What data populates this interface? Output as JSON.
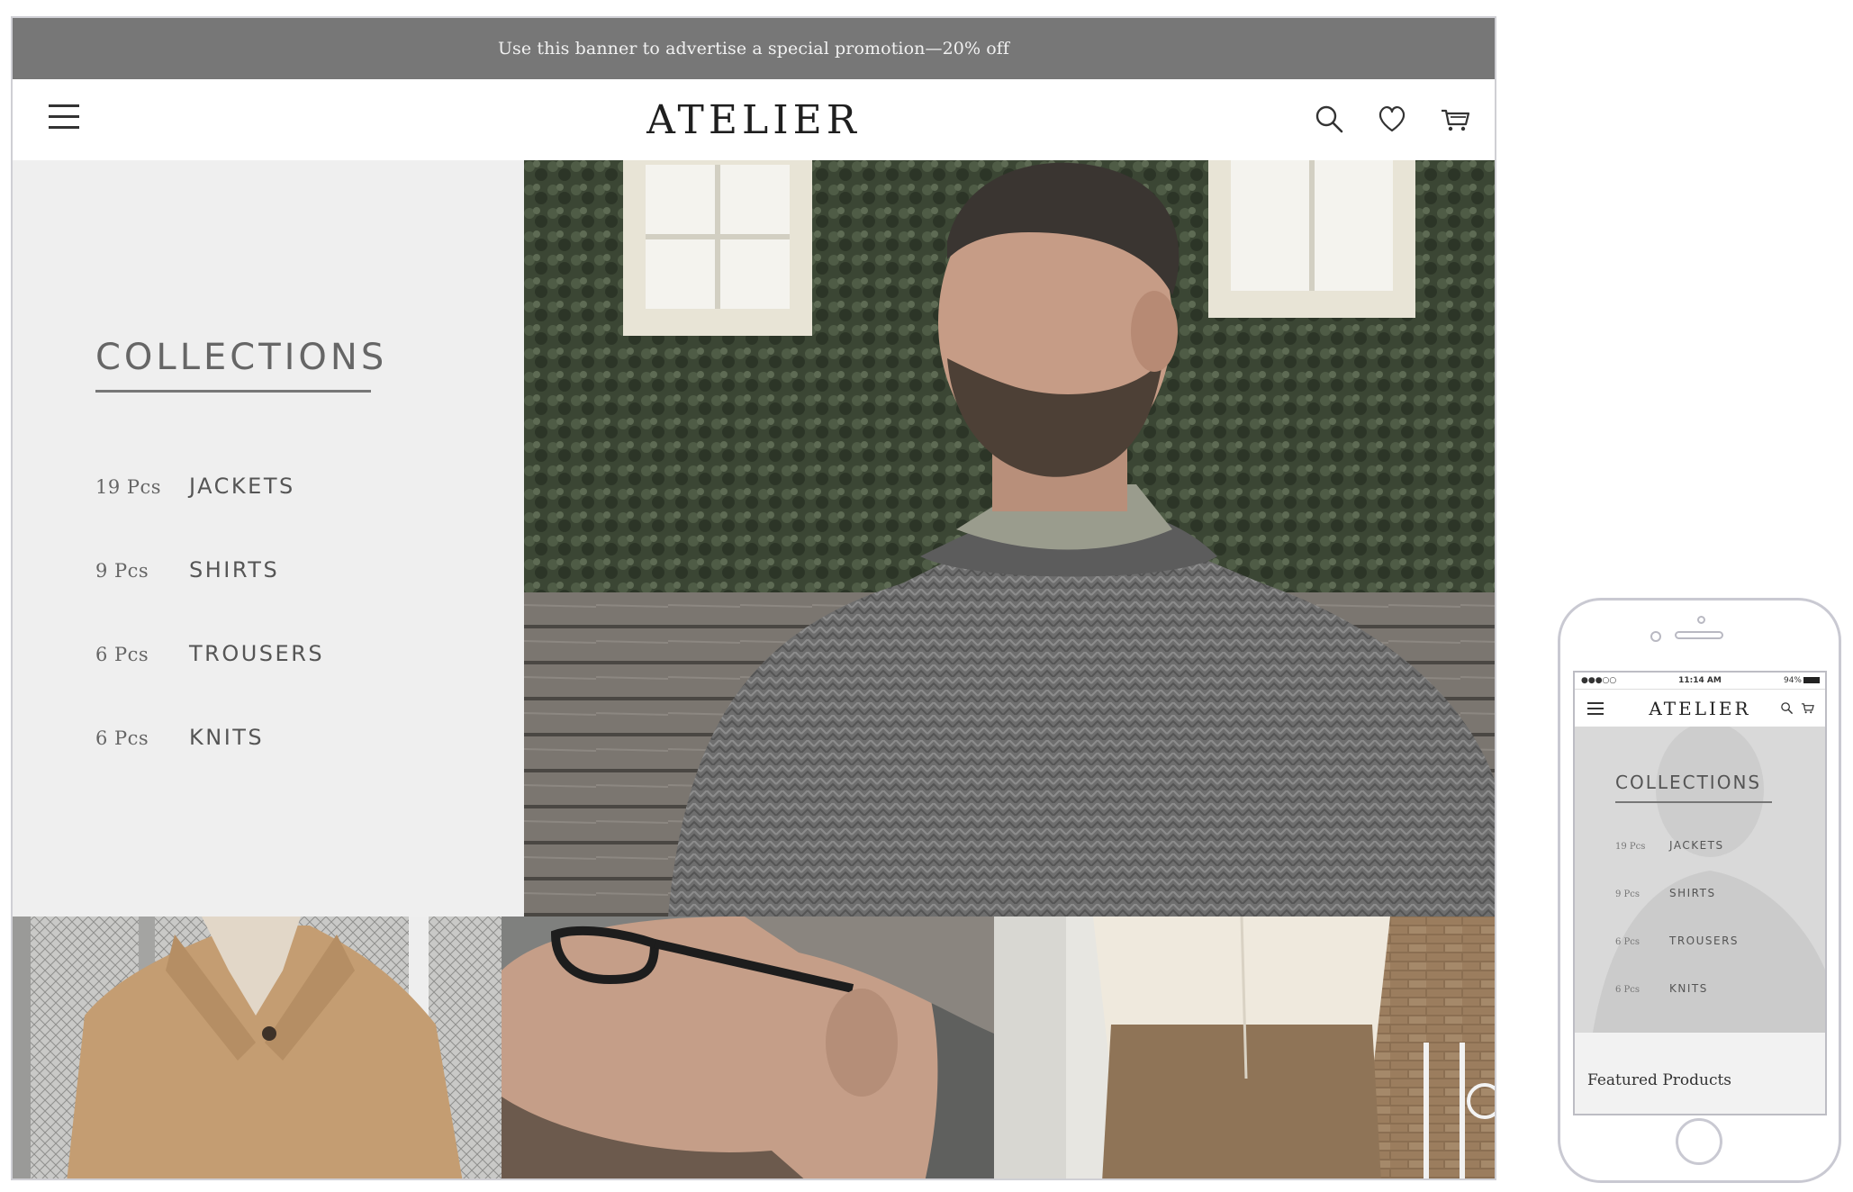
{
  "desktop": {
    "promo_text": "Use this banner to advertise a special promotion—20% off",
    "brand": "ATELIER",
    "icons": [
      "menu-icon",
      "search-icon",
      "heart-icon",
      "cart-icon"
    ],
    "collections": {
      "title": "COLLECTIONS",
      "items": [
        {
          "count": "19 Pcs",
          "name": "JACKETS"
        },
        {
          "count": "9 Pcs",
          "name": "SHIRTS"
        },
        {
          "count": "6 Pcs",
          "name": "TROUSERS"
        },
        {
          "count": "6 Pcs",
          "name": "KNITS"
        }
      ]
    },
    "images": [
      "man-grey-sweater-photo",
      "camel-coat-photo",
      "man-glasses-photo",
      "cream-shirt-trousers-photo"
    ]
  },
  "mobile": {
    "status": {
      "signal": "●●●○○",
      "time": "11:14 AM",
      "battery": "94%"
    },
    "brand": "ATELIER",
    "icons": [
      "menu-icon",
      "search-icon",
      "cart-icon"
    ],
    "collections": {
      "title": "COLLECTIONS",
      "items": [
        {
          "count": "19 Pcs",
          "name": "JACKETS"
        },
        {
          "count": "9 Pcs",
          "name": "SHIRTS"
        },
        {
          "count": "6 Pcs",
          "name": "TROUSERS"
        },
        {
          "count": "6 Pcs",
          "name": "KNITS"
        }
      ]
    },
    "featured_label": "Featured Products"
  },
  "colors": {
    "promo_bg": "#777777",
    "panel_bg": "#efefef",
    "text_dark": "#1f1f1f",
    "text_mid": "#666666"
  }
}
